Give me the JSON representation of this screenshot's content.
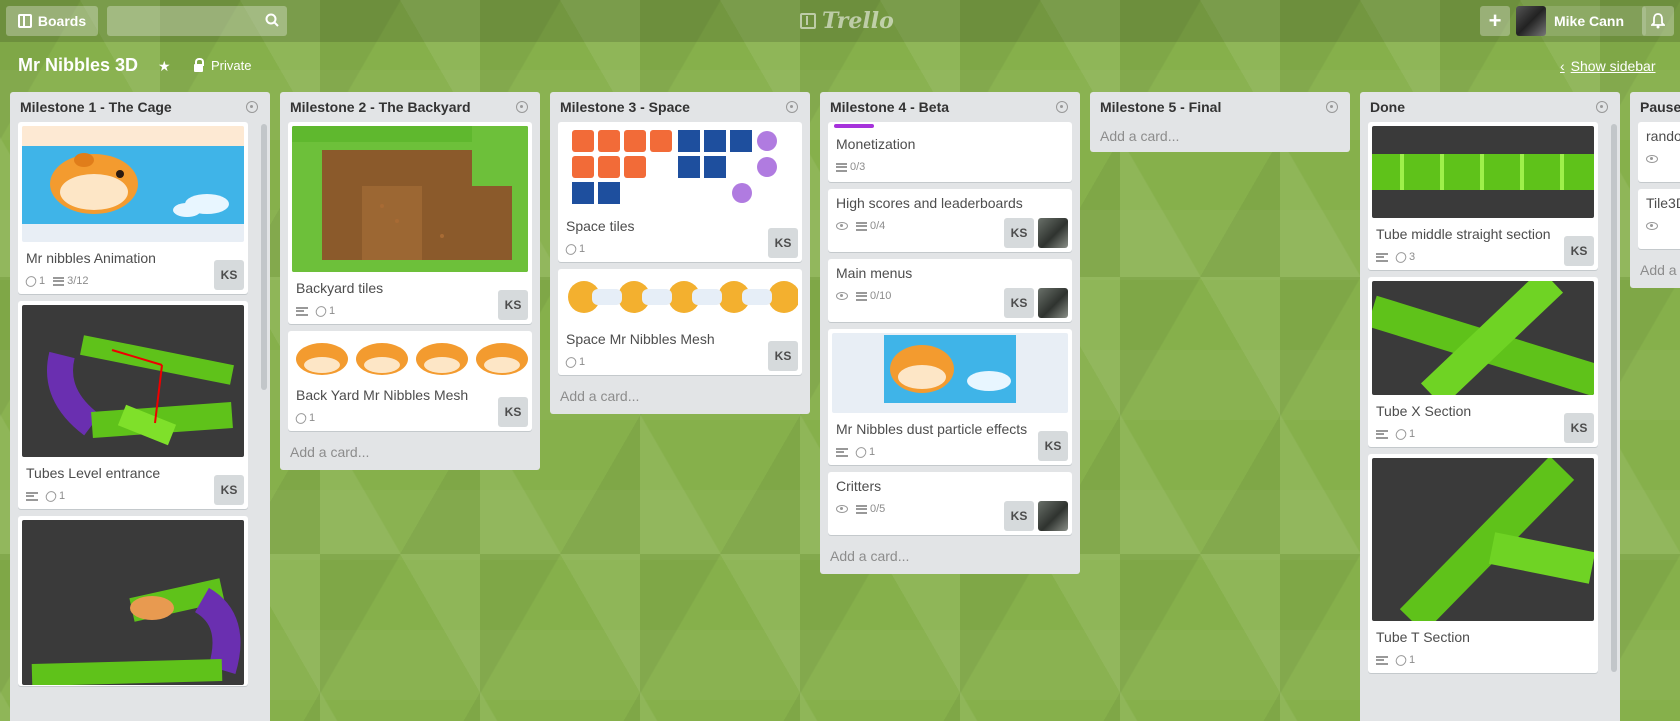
{
  "header": {
    "boards_label": "Boards",
    "search_placeholder": "",
    "logo_text": "Trello",
    "user_name": "Mike Cann"
  },
  "board": {
    "title": "Mr Nibbles 3D",
    "visibility": "Private",
    "show_sidebar": "Show sidebar"
  },
  "add_card_label": "Add a card...",
  "lists": [
    {
      "title": "Milestone 1 - The Cage",
      "cards": [
        {
          "title": "Mr nibbles Animation",
          "attachments": "1",
          "checklist": "3/12",
          "member": "KS"
        },
        {
          "title": "Tubes Level entrance",
          "attachments": "1",
          "member": "KS"
        }
      ]
    },
    {
      "title": "Milestone 2 - The Backyard",
      "cards": [
        {
          "title": "Backyard tiles",
          "attachments": "1",
          "member": "KS"
        },
        {
          "title": "Back Yard Mr Nibbles Mesh",
          "attachments": "1",
          "member": "KS"
        }
      ]
    },
    {
      "title": "Milestone 3 - Space",
      "cards": [
        {
          "title": "Space tiles",
          "attachments": "1",
          "member": "KS"
        },
        {
          "title": "Space Mr Nibbles Mesh",
          "attachments": "1",
          "member": "KS"
        }
      ]
    },
    {
      "title": "Milestone 4 - Beta",
      "cards": [
        {
          "title": "Monetization",
          "checklist": "0/3"
        },
        {
          "title": "High scores and leaderboards",
          "checklist": "0/4",
          "member": "KS"
        },
        {
          "title": "Main menus",
          "checklist": "0/10",
          "member": "KS"
        },
        {
          "title": "Mr Nibbles dust particle effects",
          "attachments": "1",
          "member": "KS"
        },
        {
          "title": "Critters",
          "checklist": "0/5",
          "member": "KS"
        }
      ]
    },
    {
      "title": "Milestone 5 - Final",
      "cards": []
    },
    {
      "title": "Done",
      "cards": [
        {
          "title": "Tube middle straight section",
          "attachments": "3",
          "member": "KS"
        },
        {
          "title": "Tube X Section",
          "attachments": "1",
          "member": "KS"
        },
        {
          "title": "Tube T Section",
          "attachments": "1"
        }
      ]
    },
    {
      "title": "Pause",
      "cards": [
        {
          "title": "rando"
        },
        {
          "title": "Tile3D"
        }
      ],
      "add_card_partial": "Add a"
    }
  ],
  "colors": {
    "background": "#86b04b",
    "list_bg": "#e2e4e6",
    "label_purple": "#a632db"
  }
}
